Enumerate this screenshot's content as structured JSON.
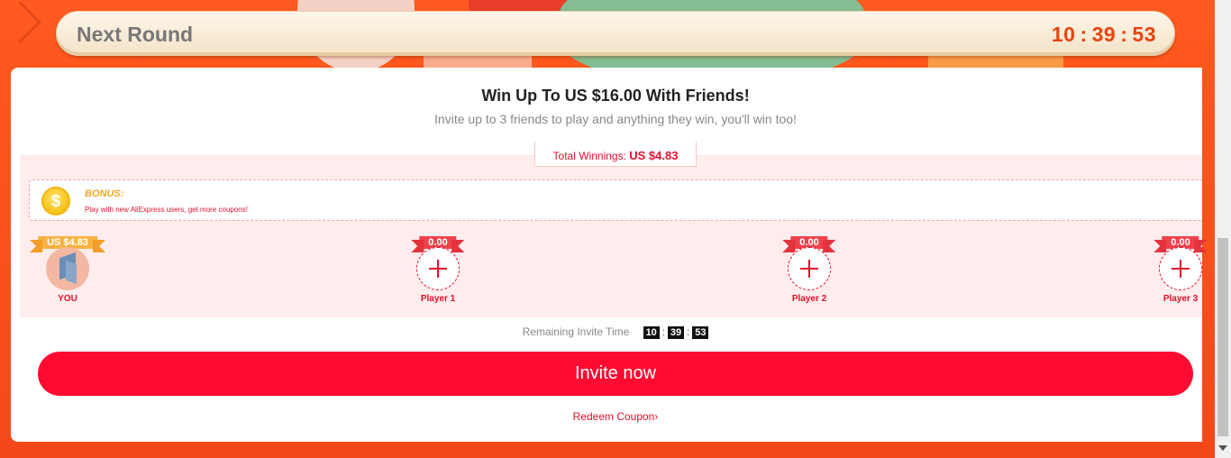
{
  "next_round": {
    "title": "Next Round",
    "timer": {
      "hours": "10",
      "minutes": "39",
      "seconds": "53"
    }
  },
  "invite_card": {
    "headline": "Win Up To US $16.00 With Friends!",
    "subline": "Invite up to 3 friends to play and anything they win, you'll win too!",
    "total_winnings_label": "Total Winnings: ",
    "total_winnings_value": "US $4.83",
    "bonus": {
      "coin_symbol": "$",
      "title": "BONUS:",
      "description": "Play with new AliExpress users, get more coupons!"
    },
    "players": [
      {
        "name": "YOU",
        "amount": "US $4.83",
        "type": "self"
      },
      {
        "name": "Player 1",
        "amount": "0.00",
        "type": "empty"
      },
      {
        "name": "Player 2",
        "amount": "0.00",
        "type": "empty"
      },
      {
        "name": "Player 3",
        "amount": "0.00",
        "type": "empty"
      }
    ],
    "remaining_invite_label": "Remaining Invite Time",
    "remaining_invite_time": {
      "hours": "10",
      "minutes": "39",
      "seconds": "53"
    },
    "invite_button": "Invite now",
    "redeem_link": "Redeem Coupon",
    "redeem_chevron": "›"
  },
  "colors": {
    "accent": "#ff0a30",
    "timer": "#e8430f",
    "background": "#f4481a",
    "bonus_title": "#f5a623"
  },
  "icons": [
    "coin-icon",
    "add-player-icon",
    "avatar-icon",
    "chevron-right-icon",
    "scroll-down-arrow-icon"
  ]
}
